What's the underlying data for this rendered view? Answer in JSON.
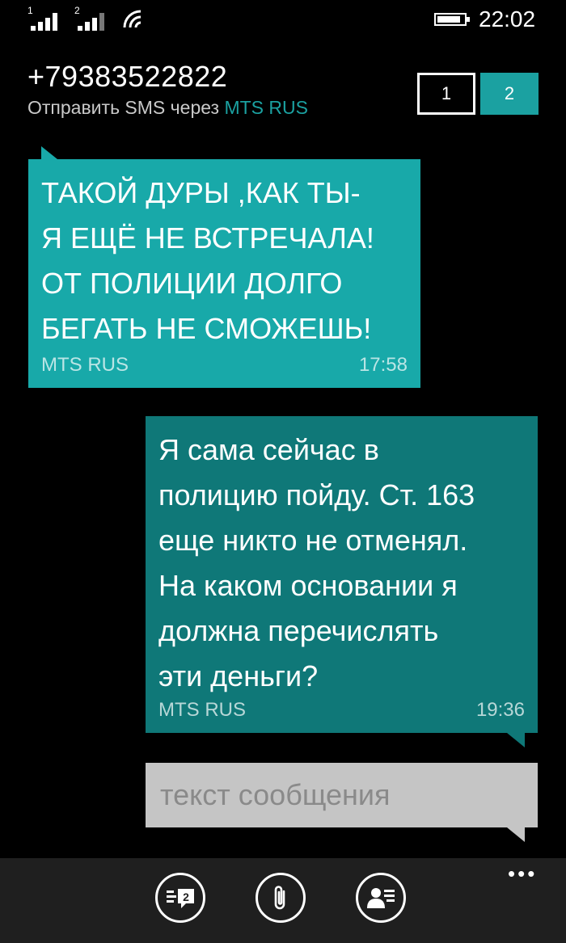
{
  "status_bar": {
    "sim1_label": "1",
    "sim2_label": "2",
    "time": "22:02"
  },
  "header": {
    "phone_number": "+79383522822",
    "send_via_prefix": "Отправить SMS через",
    "carrier": "MTS RUS",
    "sim_tabs": [
      "1",
      "2"
    ],
    "selected_sim": "2",
    "accent": "#1ba1a1"
  },
  "messages": [
    {
      "direction": "incoming",
      "text": "ТАКОЙ ДУРЫ ,КАК ТЫ-\nЯ ЕЩЁ НЕ ВСТРЕЧАЛА!\nОТ ПОЛИЦИИ ДОЛГО\nБЕГАТЬ НЕ СМОЖЕШЬ!",
      "carrier": "MTS RUS",
      "time": "17:58",
      "color": "#18a9a9"
    },
    {
      "direction": "outgoing",
      "text": "Я сама сейчас в\nполицию пойду. Ст. 163\nеще никто не отменял.\nНа каком основании я\nдолжна перечислять\nэти деньги?",
      "carrier": "MTS RUS",
      "time": "19:36",
      "color": "#0f7878"
    }
  ],
  "compose": {
    "placeholder": "текст сообщения",
    "value": ""
  },
  "app_bar": {
    "more_label": "•••",
    "buttons": [
      {
        "name": "switch-sim",
        "icon": "sms-sim-2-icon",
        "badge": "2"
      },
      {
        "name": "attach",
        "icon": "paperclip-icon"
      },
      {
        "name": "contact",
        "icon": "contact-card-icon"
      }
    ]
  }
}
